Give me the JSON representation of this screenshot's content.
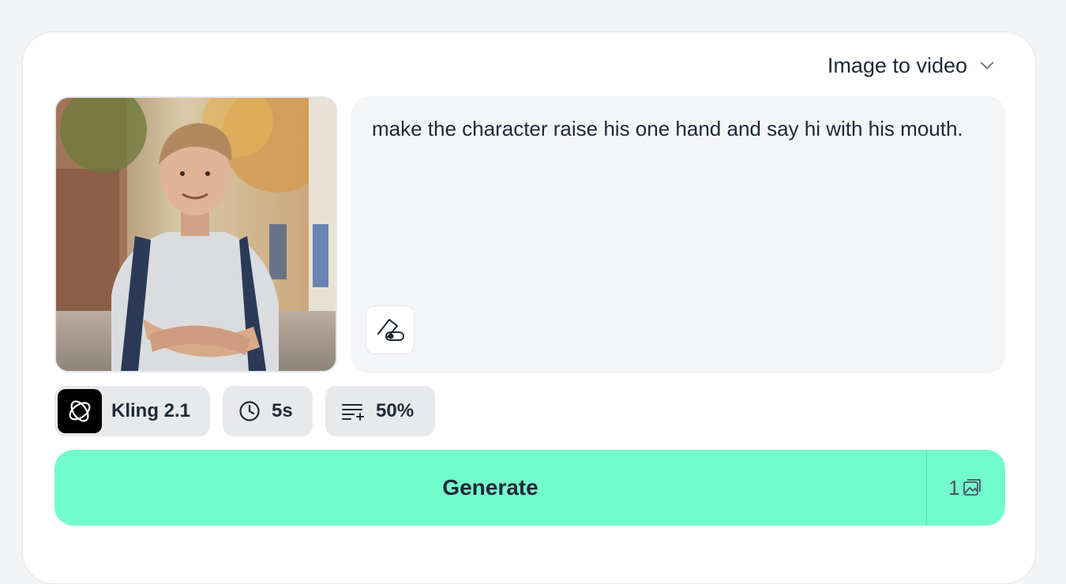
{
  "mode": {
    "label": "Image to video",
    "icon": "chevron-down-icon"
  },
  "prompt": {
    "text": "make the character raise his one hand and say hi with his mouth."
  },
  "tools": {
    "eraser_icon": "eraser-icon"
  },
  "settings": {
    "model": {
      "label": "Kling 2.1",
      "icon": "kling-logo-icon"
    },
    "duration": {
      "label": "5s",
      "icon": "clock-icon"
    },
    "quality": {
      "label": "50%",
      "icon": "prompt-strength-icon"
    }
  },
  "generate": {
    "label": "Generate",
    "credits": "1",
    "credits_icon": "image-icon"
  },
  "colors": {
    "accent": "#72fbcc",
    "card": "#ffffff",
    "page": "#f3f4f6"
  }
}
